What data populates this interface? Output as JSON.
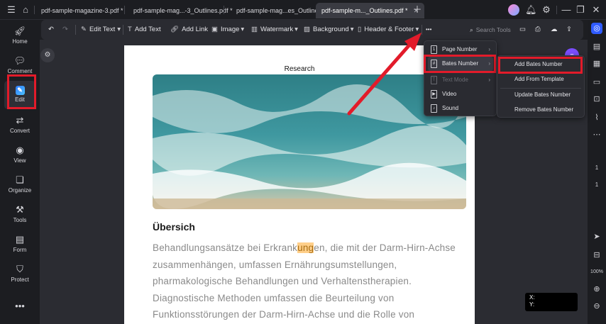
{
  "tabs": [
    {
      "label": "pdf-sample-magazine-3.pdf *",
      "active": false
    },
    {
      "label": "pdf-sample-mag...-3_Outlines.pdf *",
      "active": false
    },
    {
      "label": "pdf-sample-mag...es_Outlines.pdf *",
      "active": false
    },
    {
      "label": "pdf-sample-m..._Outlines.pdf *",
      "active": true
    }
  ],
  "sidebar": [
    {
      "label": "Home",
      "icon": "rocket-icon"
    },
    {
      "label": "Comment",
      "icon": "comment-icon"
    },
    {
      "label": "Edit",
      "icon": "edit-icon",
      "active": true
    },
    {
      "label": "Convert",
      "icon": "convert-icon"
    },
    {
      "label": "View",
      "icon": "eye-icon"
    },
    {
      "label": "Organize",
      "icon": "organize-icon"
    },
    {
      "label": "Tools",
      "icon": "toolbox-icon"
    },
    {
      "label": "Form",
      "icon": "form-icon"
    },
    {
      "label": "Protect",
      "icon": "shield-icon"
    }
  ],
  "toolbar": {
    "edit_text": "Edit Text",
    "add_text": "Add Text",
    "add_link": "Add Link",
    "image": "Image",
    "watermark": "Watermark",
    "background": "Background",
    "header_footer": "Header & Footer",
    "more": "•••",
    "search_tools": "Search Tools"
  },
  "page": {
    "title": "Research",
    "heading": "Übersich",
    "lines": [
      {
        "pre": "Behandlungsansätze bei Erkrank",
        "hl": "ung",
        "post": "en, die mit der Darm-Hirn-Achse"
      },
      {
        "pre": "zusammenhängen, umfassen Ernährungsumstellungen,",
        "hl": "",
        "post": ""
      },
      {
        "pre": "pharmakologische Behandlungen und Verhaltenstherapien.",
        "hl": "",
        "post": ""
      },
      {
        "pre": "Diagnostische Methoden umfassen die Beurteilung von",
        "hl": "",
        "post": ""
      },
      {
        "pre": "Funktionsstörungen der Darm-Hirn-Achse und die Rolle von",
        "hl": "",
        "post": ""
      }
    ]
  },
  "menu1": [
    {
      "label": "Page Number",
      "submenu": true,
      "disabled": false
    },
    {
      "label": "Bates Number",
      "submenu": true,
      "disabled": false,
      "highlighted": true
    },
    {
      "label": "Text Mode",
      "submenu": true,
      "disabled": true
    },
    {
      "label": "Video",
      "submenu": false,
      "disabled": false
    },
    {
      "label": "Sound",
      "submenu": false,
      "disabled": false
    }
  ],
  "menu2": [
    {
      "label": "Add Bates Number",
      "highlighted": true
    },
    {
      "label": "Add From Template"
    },
    {
      "label": "Update Bates Number"
    },
    {
      "label": "Remove Bates Number"
    }
  ],
  "rightrail": {
    "page_current": "1",
    "page_total": "1",
    "zoom": "100%"
  },
  "coords": {
    "x_label": "X:",
    "y_label": "Y:"
  },
  "colors": {
    "accent_red": "#e21b2a",
    "edit_blue": "#2f7bff",
    "highlight": "#ffcf8a"
  }
}
